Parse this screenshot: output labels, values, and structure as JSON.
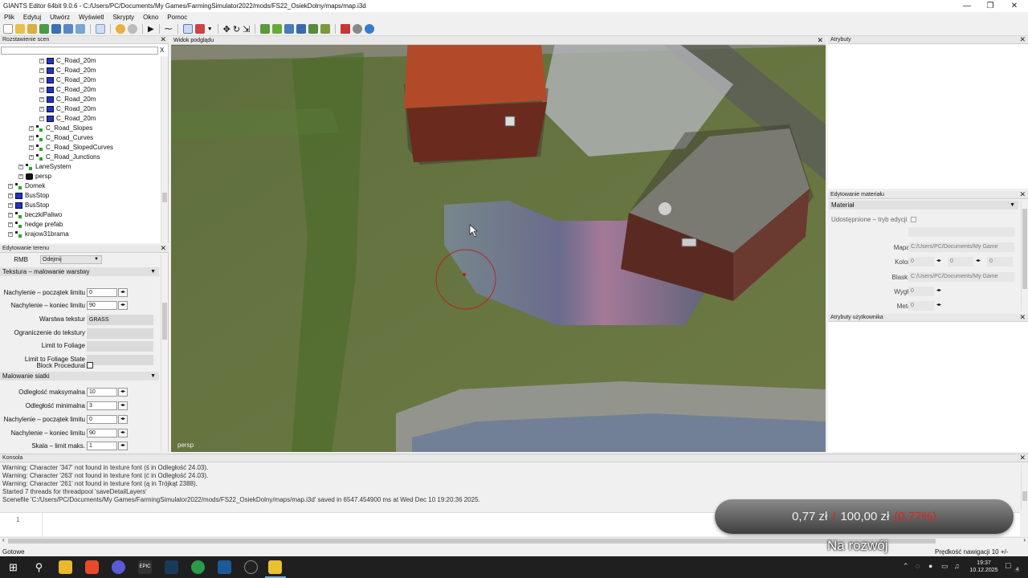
{
  "window": {
    "title": "GIANTS Editor 64bit 9.0.6 - C:/Users/PC/Documents/My Games/FarmingSimulator2022/mods/FS22_OsiekDolny/maps/map.i3d"
  },
  "menu": [
    "Plik",
    "Edytuj",
    "Utwórz",
    "Wyświetl",
    "Skrypty",
    "Okno",
    "Pomoc"
  ],
  "scene_panel": {
    "title": "Rozstawienie scen",
    "filter_clear": "X",
    "items": [
      {
        "label": "C_Road_20m",
        "indent": 5,
        "icon": "cube-icon"
      },
      {
        "label": "C_Road_20m",
        "indent": 5,
        "icon": "cube-icon"
      },
      {
        "label": "C_Road_20m",
        "indent": 5,
        "icon": "cube-icon"
      },
      {
        "label": "C_Road_20m",
        "indent": 5,
        "icon": "cube-icon"
      },
      {
        "label": "C_Road_20m",
        "indent": 5,
        "icon": "cube-icon"
      },
      {
        "label": "C_Road_20m",
        "indent": 5,
        "icon": "cube-icon"
      },
      {
        "label": "C_Road_20m",
        "indent": 5,
        "icon": "cube-icon"
      },
      {
        "label": "C_Road_Slopes",
        "indent": 4,
        "icon": "transform-group-icon"
      },
      {
        "label": "C_Road_Curves",
        "indent": 4,
        "icon": "transform-group-icon"
      },
      {
        "label": "C_Road_SlopedCurves",
        "indent": 4,
        "icon": "transform-group-icon"
      },
      {
        "label": "C_Road_Junctions",
        "indent": 4,
        "icon": "transform-group-icon"
      },
      {
        "label": "LaneSystem",
        "indent": 3,
        "icon": "transform-group-icon"
      },
      {
        "label": "persp",
        "indent": 3,
        "icon": "camera-icon"
      },
      {
        "label": "Domek",
        "indent": 2,
        "icon": "transform-group-icon"
      },
      {
        "label": "BusStop",
        "indent": 2,
        "icon": "cube-icon"
      },
      {
        "label": "BusStop",
        "indent": 2,
        "icon": "cube-icon"
      },
      {
        "label": "beczkiPaliwo",
        "indent": 2,
        "icon": "transform-group-icon"
      },
      {
        "label": "hedge prefab",
        "indent": 2,
        "icon": "transform-group-icon"
      },
      {
        "label": "krajow31brama",
        "indent": 2,
        "icon": "transform-group-icon"
      }
    ]
  },
  "terrain_panel": {
    "title": "Edytowanie terenu",
    "rmb_label": "RMB",
    "rmb_value": "Odejmij",
    "section1": "Tekstura – malowanie warstwy",
    "fields1": [
      {
        "label": "Nachylenie – początek limitu",
        "value": "0",
        "kind": "num"
      },
      {
        "label": "Nachylenie – koniec limitu",
        "value": "90",
        "kind": "num"
      },
      {
        "label": "Warstwa tekstur",
        "value": "GRASS",
        "kind": "gray"
      },
      {
        "label": "Ograniczenie do tekstury",
        "value": "",
        "kind": "gray"
      },
      {
        "label": "Limit to Foliage",
        "value": "",
        "kind": "gray"
      },
      {
        "label": "Limit to Foliage State",
        "value": "",
        "kind": "gray"
      }
    ],
    "block_procedural": "Block Procedural",
    "section2": "Malowanie siatki",
    "fields2": [
      {
        "label": "Odległość maksymalna",
        "value": "10"
      },
      {
        "label": "Odległość minimalna",
        "value": "3"
      },
      {
        "label": "Nachylenie – początek limitu",
        "value": "0"
      },
      {
        "label": "Nachylenie – koniec limitu",
        "value": "90"
      },
      {
        "label": "Skala – limit maks.",
        "value": "1"
      }
    ]
  },
  "viewport": {
    "title": "Widok podglądu",
    "camera": "persp"
  },
  "attributes_panel": {
    "title": "Atrybuty"
  },
  "material_panel": {
    "title": "Edytowanie materiału",
    "dropdown": "Materiał",
    "shared_label": "Udostępnione – tryb edycji",
    "rows": [
      {
        "label": "Materiał",
        "value": ""
      },
      {
        "label": "Mapa albedo",
        "value": "C:/Users/PC/Documents/My Game"
      },
      {
        "label": "Kolor albedo",
        "value": "0"
      },
      {
        "label": "Blask – mapa",
        "value": "C:/Users/PC/Documents/My Game"
      },
      {
        "label": "Wygładzenie",
        "value": "0"
      },
      {
        "label": "Metalowość",
        "value": "0"
      }
    ],
    "albedo_g": "0",
    "albedo_b": "0"
  },
  "user_attrs_panel": {
    "title": "Atrybuty użytkownika"
  },
  "console": {
    "title": "Konsola",
    "lines": [
      "Warning: Character '347' not found in texture font (ś in Odległość 24.03).",
      "Warning: Character '263' not found in texture font (ć in Odległość 24.03).",
      "Warning: Character '261' not found in texture font (ą in Trójkąt 2388).",
      "Started 7 threads for threadpool 'saveDetailLayers'",
      "Scenefile 'C:/Users/PC/Documents/My Games/FarmingSimulator2022/mods/FS22_OsiekDolny/maps/map.i3d' saved in 6547.454900 ms at Wed Dec 10 19:20:36 2025."
    ],
    "line_number": "1"
  },
  "status": {
    "left": "Gotowe",
    "right": "Prędkość nawigacji 10 +/-"
  },
  "overlay": {
    "amount": "0,77 zł",
    "slash": "/",
    "goal": "100,00 zł",
    "percent": "(0.77%)",
    "caption": "Na rozwój"
  },
  "taskbar": {
    "time": "19:37",
    "date": "10.12.2025",
    "notif": "4"
  },
  "colors": {
    "accent": "#2233cc",
    "overlay_red": "#e02020"
  }
}
